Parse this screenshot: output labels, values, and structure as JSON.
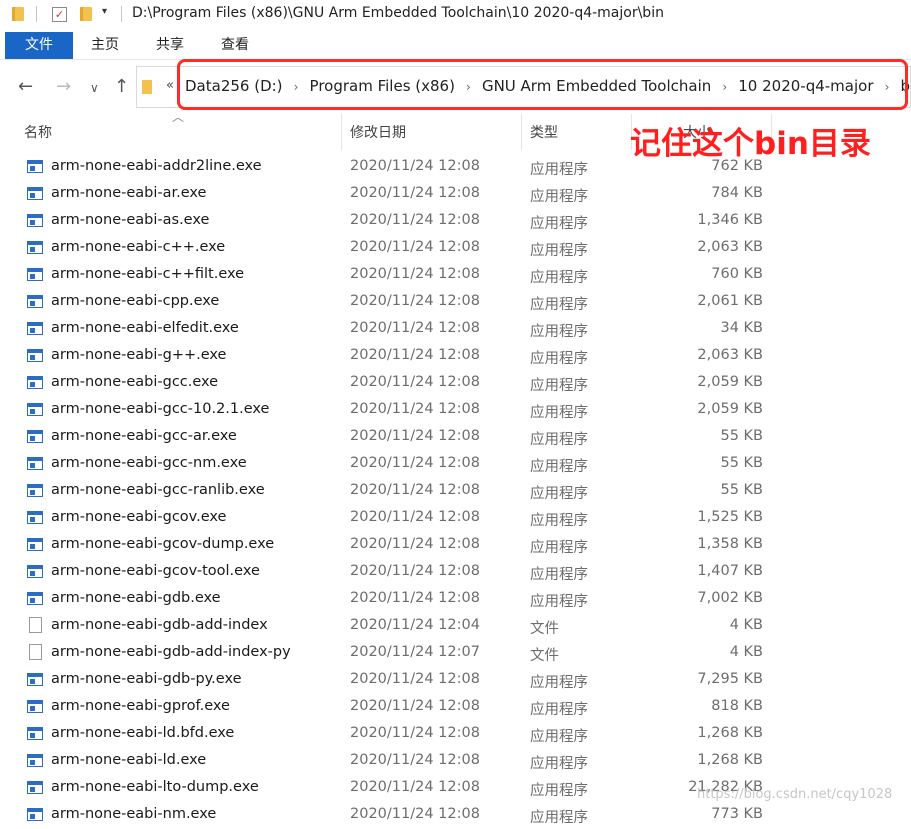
{
  "window": {
    "title": "D:\\Program Files (x86)\\GNU Arm Embedded Toolchain\\10 2020-q4-major\\bin"
  },
  "ribbon": {
    "tabs": [
      "文件",
      "主页",
      "共享",
      "查看"
    ]
  },
  "address": {
    "more": "«",
    "crumbs": [
      "Data256 (D:)",
      "Program Files (x86)",
      "GNU Arm Embedded Toolchain",
      "10 2020-q4-major",
      "bin"
    ]
  },
  "columns": {
    "name": "名称",
    "date": "修改日期",
    "type": "类型",
    "size": "大小"
  },
  "annotation": {
    "text": "记住这个bin目录",
    "color": "#ff1f1f"
  },
  "files": [
    {
      "name": "arm-none-eabi-addr2line.exe",
      "date": "2020/11/24 12:08",
      "type": "应用程序",
      "size": "762 KB",
      "icon": "exe"
    },
    {
      "name": "arm-none-eabi-ar.exe",
      "date": "2020/11/24 12:08",
      "type": "应用程序",
      "size": "784 KB",
      "icon": "exe"
    },
    {
      "name": "arm-none-eabi-as.exe",
      "date": "2020/11/24 12:08",
      "type": "应用程序",
      "size": "1,346 KB",
      "icon": "exe"
    },
    {
      "name": "arm-none-eabi-c++.exe",
      "date": "2020/11/24 12:08",
      "type": "应用程序",
      "size": "2,063 KB",
      "icon": "exe"
    },
    {
      "name": "arm-none-eabi-c++filt.exe",
      "date": "2020/11/24 12:08",
      "type": "应用程序",
      "size": "760 KB",
      "icon": "exe"
    },
    {
      "name": "arm-none-eabi-cpp.exe",
      "date": "2020/11/24 12:08",
      "type": "应用程序",
      "size": "2,061 KB",
      "icon": "exe"
    },
    {
      "name": "arm-none-eabi-elfedit.exe",
      "date": "2020/11/24 12:08",
      "type": "应用程序",
      "size": "34 KB",
      "icon": "exe"
    },
    {
      "name": "arm-none-eabi-g++.exe",
      "date": "2020/11/24 12:08",
      "type": "应用程序",
      "size": "2,063 KB",
      "icon": "exe"
    },
    {
      "name": "arm-none-eabi-gcc.exe",
      "date": "2020/11/24 12:08",
      "type": "应用程序",
      "size": "2,059 KB",
      "icon": "exe"
    },
    {
      "name": "arm-none-eabi-gcc-10.2.1.exe",
      "date": "2020/11/24 12:08",
      "type": "应用程序",
      "size": "2,059 KB",
      "icon": "exe"
    },
    {
      "name": "arm-none-eabi-gcc-ar.exe",
      "date": "2020/11/24 12:08",
      "type": "应用程序",
      "size": "55 KB",
      "icon": "exe"
    },
    {
      "name": "arm-none-eabi-gcc-nm.exe",
      "date": "2020/11/24 12:08",
      "type": "应用程序",
      "size": "55 KB",
      "icon": "exe"
    },
    {
      "name": "arm-none-eabi-gcc-ranlib.exe",
      "date": "2020/11/24 12:08",
      "type": "应用程序",
      "size": "55 KB",
      "icon": "exe"
    },
    {
      "name": "arm-none-eabi-gcov.exe",
      "date": "2020/11/24 12:08",
      "type": "应用程序",
      "size": "1,525 KB",
      "icon": "exe"
    },
    {
      "name": "arm-none-eabi-gcov-dump.exe",
      "date": "2020/11/24 12:08",
      "type": "应用程序",
      "size": "1,358 KB",
      "icon": "exe"
    },
    {
      "name": "arm-none-eabi-gcov-tool.exe",
      "date": "2020/11/24 12:08",
      "type": "应用程序",
      "size": "1,407 KB",
      "icon": "exe"
    },
    {
      "name": "arm-none-eabi-gdb.exe",
      "date": "2020/11/24 12:08",
      "type": "应用程序",
      "size": "7,002 KB",
      "icon": "exe"
    },
    {
      "name": "arm-none-eabi-gdb-add-index",
      "date": "2020/11/24 12:04",
      "type": "文件",
      "size": "4 KB",
      "icon": "file"
    },
    {
      "name": "arm-none-eabi-gdb-add-index-py",
      "date": "2020/11/24 12:07",
      "type": "文件",
      "size": "4 KB",
      "icon": "file"
    },
    {
      "name": "arm-none-eabi-gdb-py.exe",
      "date": "2020/11/24 12:08",
      "type": "应用程序",
      "size": "7,295 KB",
      "icon": "exe"
    },
    {
      "name": "arm-none-eabi-gprof.exe",
      "date": "2020/11/24 12:08",
      "type": "应用程序",
      "size": "818 KB",
      "icon": "exe"
    },
    {
      "name": "arm-none-eabi-ld.bfd.exe",
      "date": "2020/11/24 12:08",
      "type": "应用程序",
      "size": "1,268 KB",
      "icon": "exe"
    },
    {
      "name": "arm-none-eabi-ld.exe",
      "date": "2020/11/24 12:08",
      "type": "应用程序",
      "size": "1,268 KB",
      "icon": "exe"
    },
    {
      "name": "arm-none-eabi-lto-dump.exe",
      "date": "2020/11/24 12:08",
      "type": "应用程序",
      "size": "21,282 KB",
      "icon": "exe"
    },
    {
      "name": "arm-none-eabi-nm.exe",
      "date": "2020/11/24 12:08",
      "type": "应用程序",
      "size": "773 KB",
      "icon": "exe"
    }
  ],
  "watermark": "https://blog.csdn.net/cqy1028"
}
